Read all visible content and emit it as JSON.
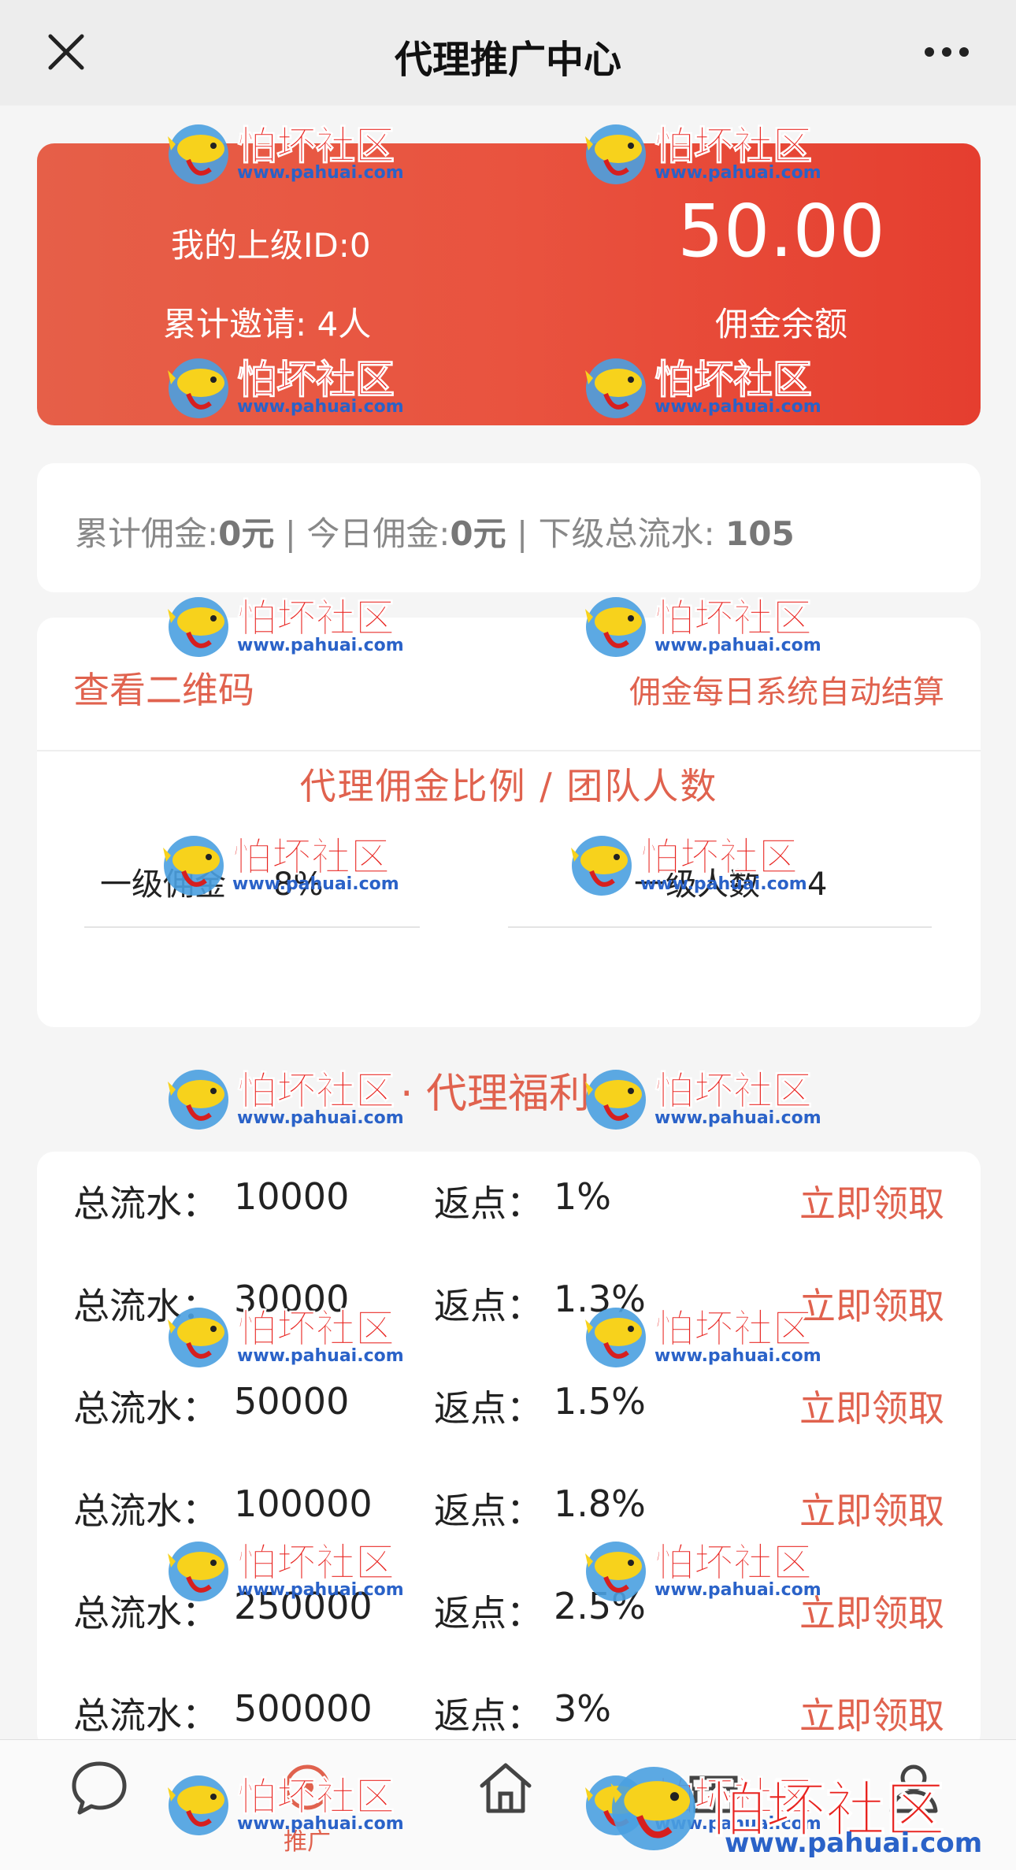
{
  "header": {
    "title": "代理推广中心"
  },
  "balance_card": {
    "parent_id": "我的上级ID:0",
    "invited": "累计邀请: 4人",
    "amount": "50.00",
    "amount_label": "佣金余额"
  },
  "stats": {
    "total_label": "累计佣金:",
    "total_value": "0元",
    "today_label": "今日佣金:",
    "today_value": "0元",
    "flow_label": "下级总流水:",
    "flow_value": "105",
    "sep": " | "
  },
  "rate_card": {
    "qr_link": "查看二维码",
    "settle_note": "佣金每日系统自动结算",
    "section_title": "代理佣金比例 / 团队人数",
    "level_rate_label": "一级佣金",
    "level_rate_value": "8%",
    "level_count_label": "一级人数",
    "level_count_value": "4"
  },
  "welfare": {
    "heading": "· 代理福利 ·"
  },
  "rebates": {
    "flow_label": "总流水：",
    "rate_label": "返点：",
    "claim_label": "立即领取",
    "rows": [
      {
        "flow": "10000",
        "rate": "1%"
      },
      {
        "flow": "30000",
        "rate": "1.3%"
      },
      {
        "flow": "50000",
        "rate": "1.5%"
      },
      {
        "flow": "100000",
        "rate": "1.8%"
      },
      {
        "flow": "250000",
        "rate": "2.5%"
      },
      {
        "flow": "500000",
        "rate": "3%"
      }
    ]
  },
  "tabbar": {
    "promo_label": "推广"
  },
  "watermark": {
    "text": "怕坏社区",
    "url": "www.pahuai.com"
  },
  "colors": {
    "accent": "#e0624e",
    "card_red": "#e9533f",
    "watermark_red": "#e8231f",
    "watermark_blue": "#2a62c8"
  }
}
